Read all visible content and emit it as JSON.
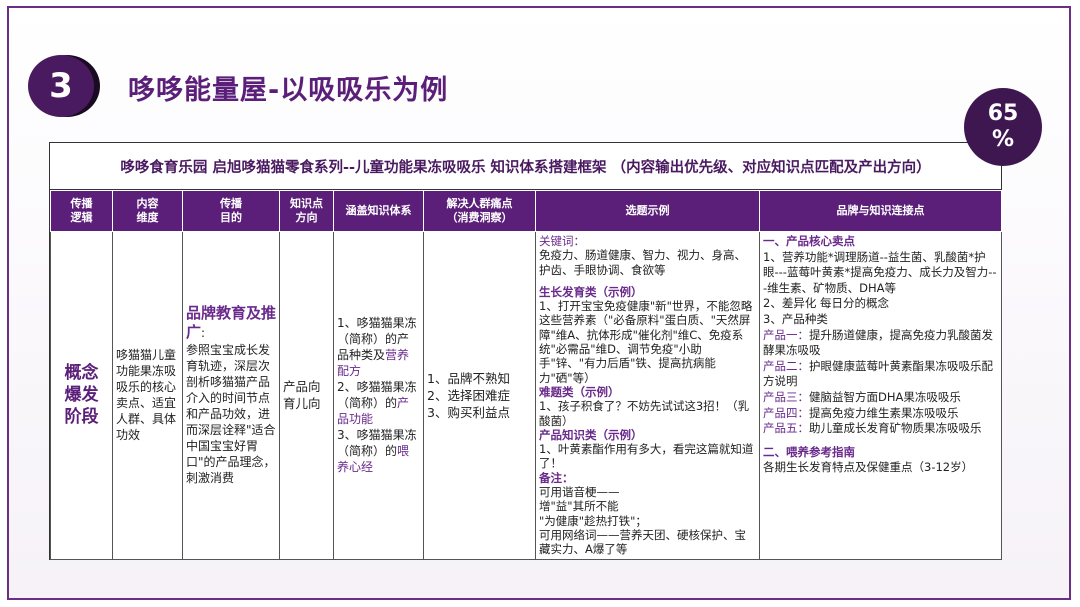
{
  "section_number": "3",
  "title": "哆哆能量屋-以吸吸乐为例",
  "progress": {
    "line1": "65",
    "line2": "%"
  },
  "table": {
    "title": "哆哆食育乐园 启旭哆猫猫零食系列--儿童功能果冻吸吸乐 知识体系搭建框架 （内容输出优先级、对应知识点匹配及产出方向）",
    "headers": {
      "col1": [
        "传播",
        "逻辑"
      ],
      "col2": [
        "内容",
        "维度"
      ],
      "col3": [
        "传播",
        "目的"
      ],
      "col4": [
        "知识点",
        "方向"
      ],
      "col5": [
        "涵盖知识体系"
      ],
      "col6": [
        "解决人群痛点",
        "（消费洞察）"
      ],
      "col7": [
        "选题示例"
      ],
      "col8": [
        "品牌与知识连接点"
      ]
    },
    "row": {
      "stage": [
        "概念",
        "爆发",
        "阶段"
      ],
      "content_dimension": "哆猫猫儿童功能果冻吸吸乐的核心卖点、适宜人群、具体功效",
      "purpose_head": "品牌教育及推广",
      "purpose_colon": ":",
      "purpose_body": "参照宝宝成长发育轨迹，深层次剖析哆猫猫产品介入的时间节点和产品功效，进而深层诠释\"适合中国宝宝好胃口\"的产品理念，刺激消费",
      "knowledge_direction": "产品向育儿向",
      "coverage": {
        "l1a": "1、哆猫猫果冻（简称）的产品种类及",
        "l1b": "营养配方",
        "l2a": "2、哆猫猫果冻（简称）的",
        "l2b": "产品功能",
        "l3a": "3、哆猫猫果冻（简称）的",
        "l3b": "喂养心经"
      },
      "pain_points": [
        "1、品牌不熟知",
        "2、选择困难症",
        "3、购买利益点"
      ],
      "topics": {
        "keywords_label": "关键词：",
        "keywords": "免疫力、肠道健康、智力、视力、身高、护齿、手眼协调、食欲等",
        "growth_label": "生长发育类（示例）",
        "growth": "1、打开宝宝免疫健康\"新\"世界，不能忽略这些营养素（\"必备原料\"蛋白质、\"天然屏障\"维A、抗体形成\"催化剂\"维C、免疫系统\"必需品\"维D、调节免疫\"小助手\"锌、\"有力后盾\"铁、提高抗病能力\"硒\"等）",
        "hard_label": "难题类（示例）",
        "hard": "1、孩子积食了？不妨先试试这3招！（乳酸菌）",
        "product_label": "产品知识类（示例）",
        "product": "1、叶黄素酯作用有多大，看完这篇就知道了！",
        "note_label": "备注：",
        "note1": "可用谐音梗——",
        "note2": "增\"益\"其所不能",
        "note3": "\"为健康\"趁热打铁\"；",
        "note4": "可用网络词——营养天团、硬核保护、宝藏实力、A爆了等"
      },
      "brand": {
        "s1_label": "一、产品核心卖点",
        "s1_p1": "1、营养功能*调理肠道--益生菌、乳酸菌*护眼---蓝莓叶黄素*提高免疫力、成长力及智力---维生素、矿物质、DHA等",
        "s1_p2": "2、差异化 每日分的概念",
        "s1_p3": "3、产品种类",
        "p1_label": "产品一：",
        "p1": "提升肠道健康，提高免疫力乳酸菌发酵果冻吸吸",
        "p2_label": "产品二：",
        "p2": "护眼健康蓝莓叶黄素酯果冻吸吸乐配方说明",
        "p3_label": "产品三：",
        "p3": "健脑益智方面DHA果冻吸吸乐",
        "p4_label": "产品四：",
        "p4": "提高免疫力维生素果冻吸吸乐",
        "p5_label": "产品五：",
        "p5": "助儿童成长发育矿物质果冻吸吸乐",
        "s2_label": "二、喂养参考指南",
        "s2": "各期生长发育特点及保健重点（3-12岁）"
      }
    }
  },
  "colors": {
    "primary": "#5b1f7a",
    "accent_text": "#6a2a8c",
    "dark_circle": "#3f1750"
  }
}
